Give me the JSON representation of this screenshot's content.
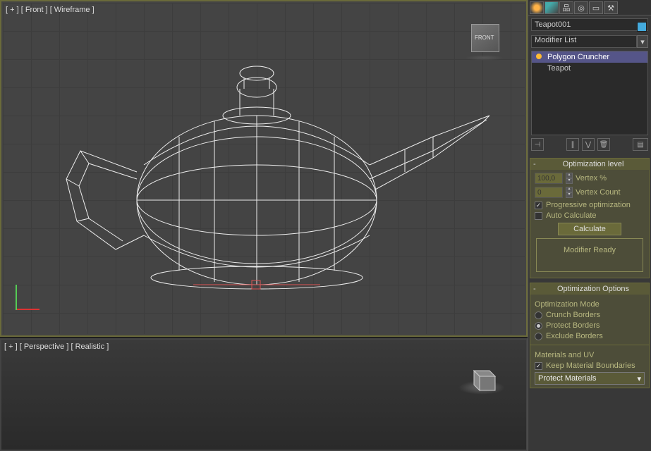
{
  "viewports": {
    "top": {
      "plus": "[ + ]",
      "name": "[ Front ]",
      "mode": "[ Wireframe ]",
      "cube_face": "FRONT"
    },
    "bottom": {
      "plus": "[ + ]",
      "name": "[ Perspective ]",
      "mode": "[ Realistic ]"
    }
  },
  "object_name": "Teapot001",
  "modifier_list_label": "Modifier List",
  "stack": [
    {
      "label": "Polygon Cruncher",
      "selected": true,
      "bulb": true
    },
    {
      "label": "Teapot",
      "selected": false,
      "bulb": false
    }
  ],
  "rollup_opt_level": {
    "title": "Optimization level",
    "vertex_pct_value": "100,0",
    "vertex_pct_label": "Vertex %",
    "vertex_count_value": "0",
    "vertex_count_label": "Vertex Count",
    "progressive_label": "Progressive optimization",
    "progressive_checked": true,
    "autocalc_label": "Auto Calculate",
    "autocalc_checked": false,
    "calc_btn": "Calculate",
    "ready_text": "Modifier Ready"
  },
  "rollup_opt_options": {
    "title": "Optimization Options",
    "mode_group": "Optimization Mode",
    "modes": [
      {
        "label": "Crunch Borders",
        "on": false
      },
      {
        "label": "Protect Borders",
        "on": true
      },
      {
        "label": "Exclude Borders",
        "on": false
      }
    ],
    "mat_group": "Materials and UV",
    "keep_mat_label": "Keep Material Boundaries",
    "keep_mat_checked": true,
    "mat_dropdown": "Protect Materials"
  }
}
